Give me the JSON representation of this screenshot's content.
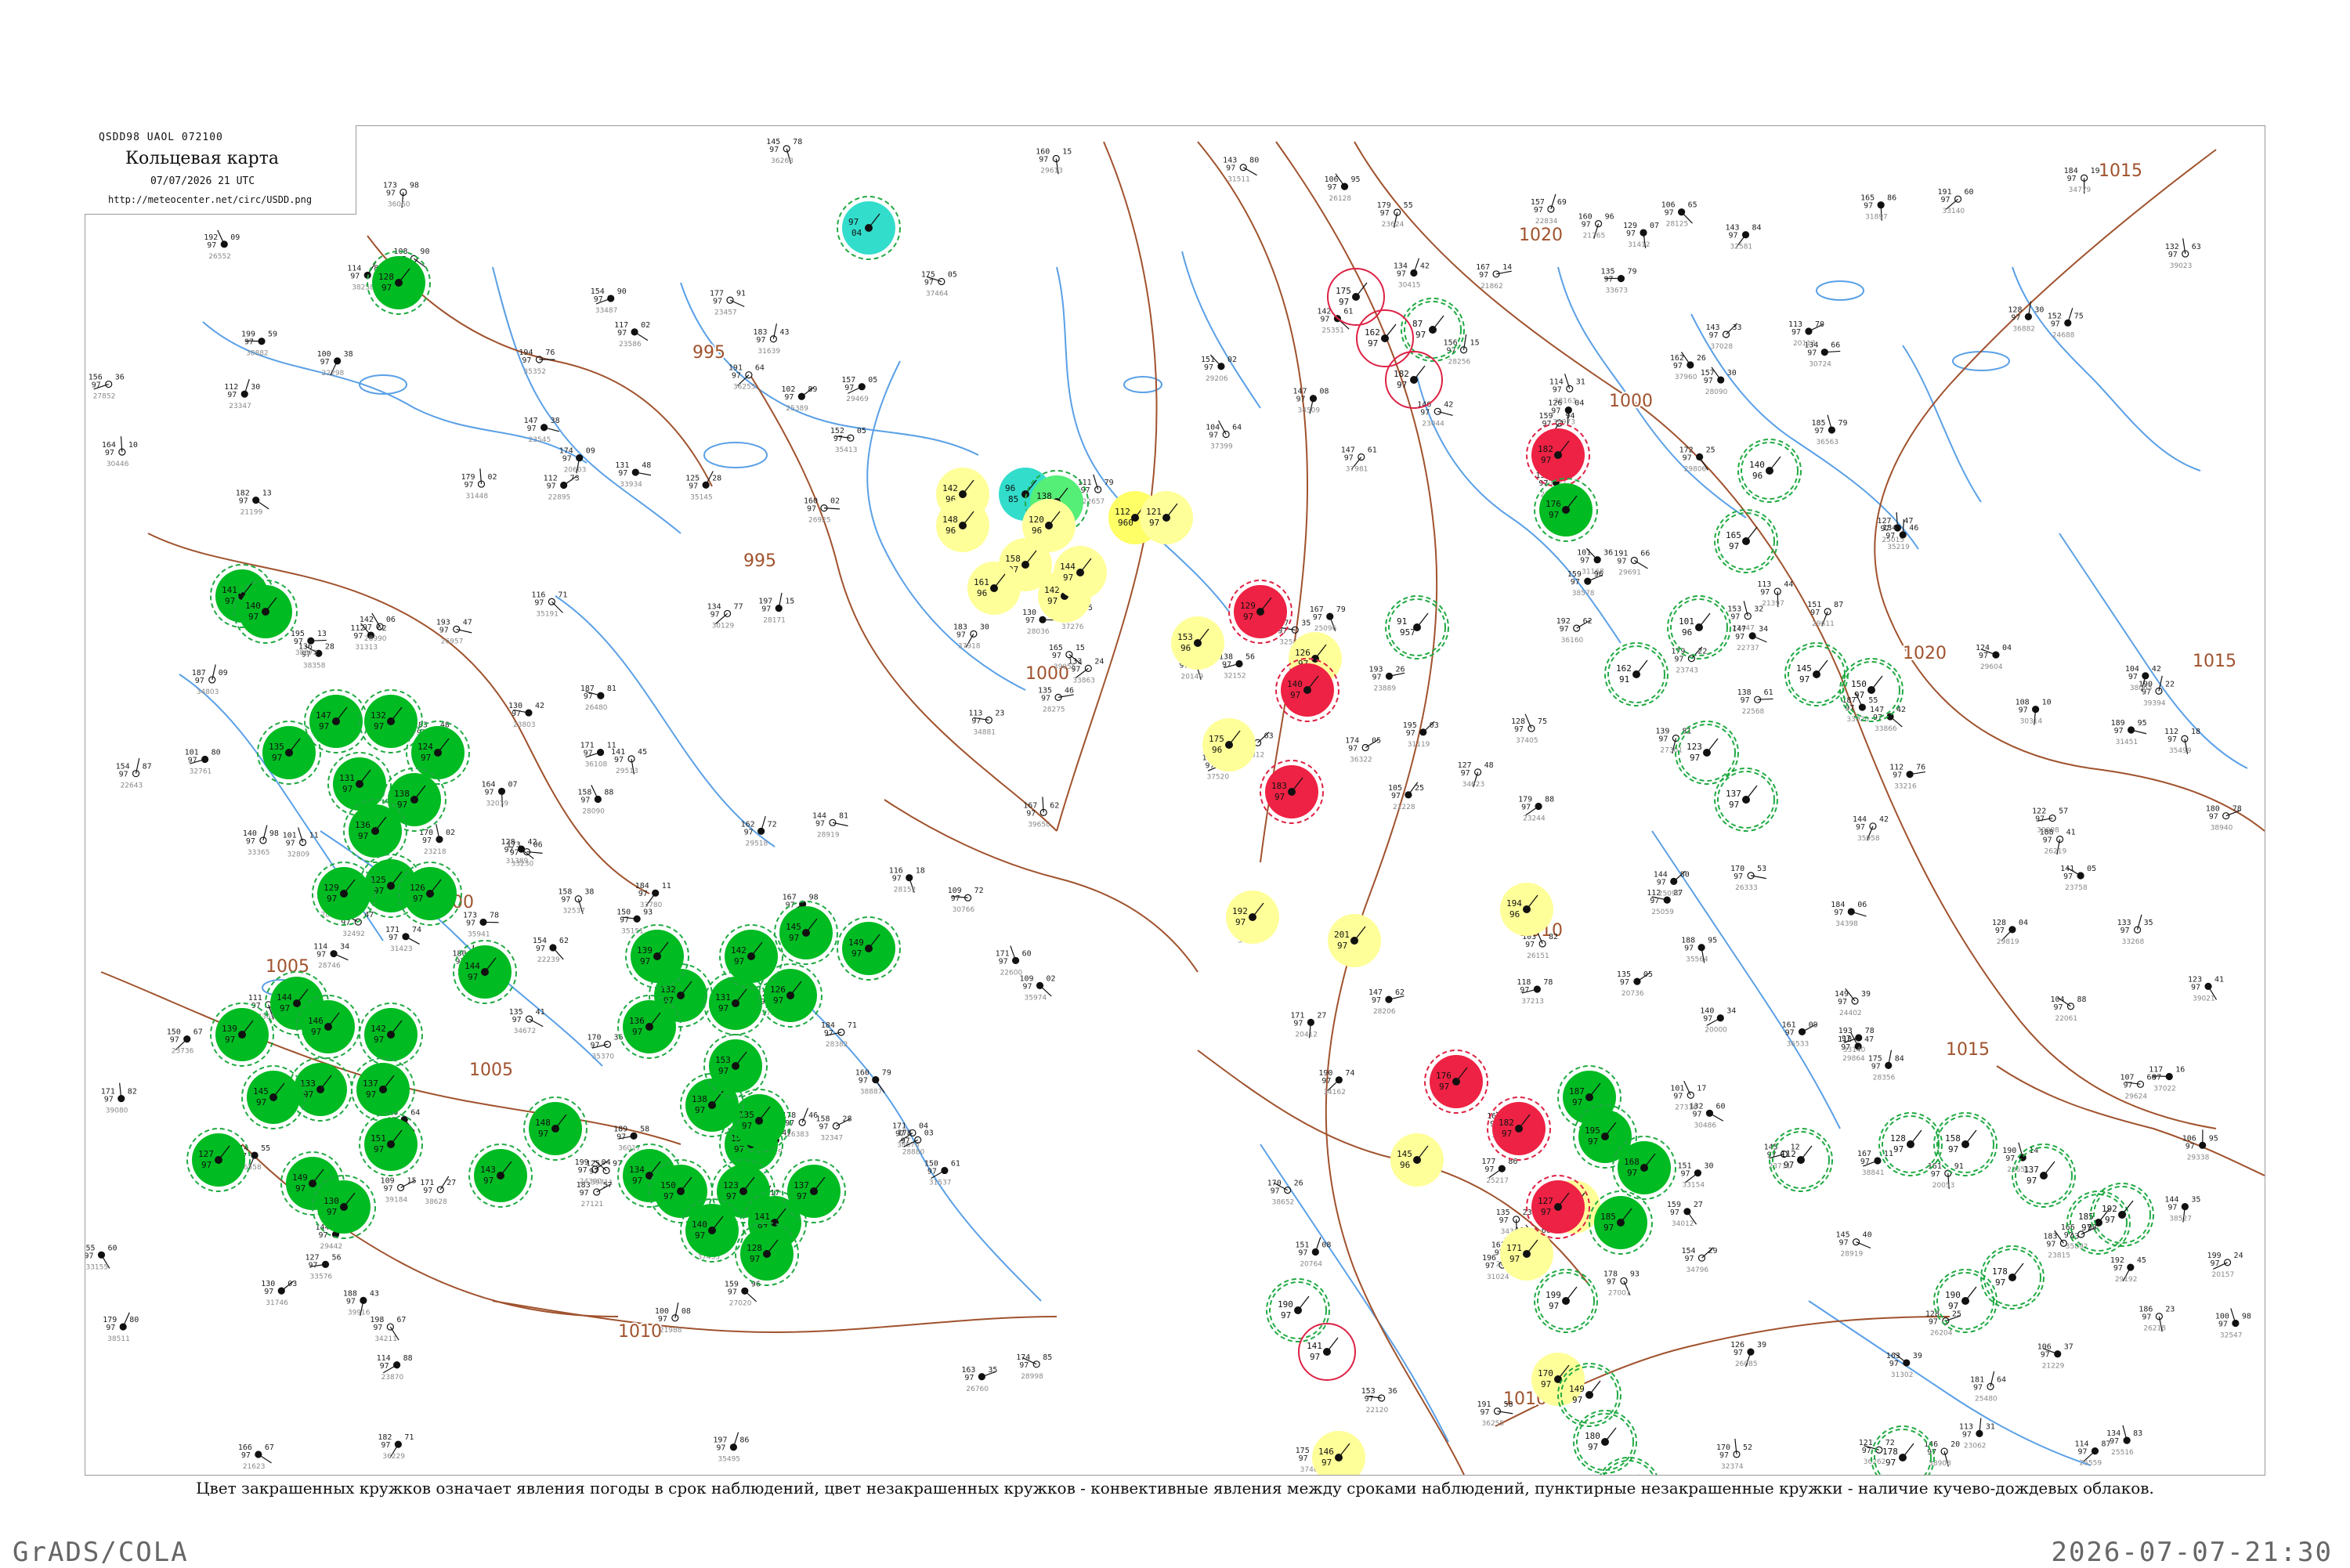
{
  "header": {
    "code": "QSDD98  UAOL  072100",
    "title": "Кольцевая карта",
    "datetime": "07/07/2026 21 UTC",
    "url": "http://meteocenter.net/circ/USDD.png"
  },
  "legend": {
    "text": "Цвет закрашенных кружков означает явления погоды в срок наблюдений, цвет незакрашенных кружков - конвективные явления между сроками наблюдений, пунктирные незакрашенные кружки - наличие кучево-дождевых облаков."
  },
  "footer": {
    "left": "GrADS/COLA",
    "right": "2026-07-07-21:30"
  },
  "colors": {
    "isobar": "#a0522d",
    "river": "#5aa0e6",
    "fill_green": "#00bb22",
    "fill_yellow": "#ffff66",
    "fill_light_yellow": "#ffff99",
    "fill_red": "#ee2244",
    "fill_cyan": "#33ddcc",
    "fill_light_green": "#55ee77",
    "ring_green": "#22aa44",
    "ring_red": "#dd2244",
    "frame": "#9a9a9a"
  },
  "isobar_labels": [
    {
      "text": "1015"
    },
    {
      "text": "1015"
    },
    {
      "text": "1020"
    },
    {
      "text": "1020"
    },
    {
      "text": "1000"
    },
    {
      "text": "1000"
    },
    {
      "text": "995"
    },
    {
      "text": "995"
    },
    {
      "text": "1005"
    },
    {
      "text": "1010"
    },
    {
      "text": "1010"
    },
    {
      "text": "1010"
    },
    {
      "text": "1015"
    },
    {
      "text": "1000"
    },
    {
      "text": "1005"
    }
  ],
  "stations": [
    {
      "kind": "fill_green",
      "dashed": true,
      "t": "128",
      "td": "97"
    },
    {
      "kind": "fill_green",
      "dashed": true,
      "t": "141",
      "td": "97"
    },
    {
      "kind": "fill_green",
      "dashed": true,
      "t": "140",
      "td": "97"
    },
    {
      "kind": "fill_green",
      "dashed": true,
      "t": "135",
      "td": "97"
    },
    {
      "kind": "fill_green",
      "dashed": true,
      "t": "147",
      "td": "97"
    },
    {
      "kind": "fill_green",
      "dashed": true,
      "t": "132",
      "td": "97"
    },
    {
      "kind": "fill_green",
      "dashed": true,
      "t": "124",
      "td": "97"
    },
    {
      "kind": "fill_green",
      "dashed": true,
      "t": "131",
      "td": "97"
    },
    {
      "kind": "fill_green",
      "dashed": true,
      "t": "138",
      "td": "97"
    },
    {
      "kind": "fill_green",
      "dashed": true,
      "t": "136",
      "td": "97"
    },
    {
      "kind": "fill_green",
      "dashed": true,
      "t": "125",
      "td": "97"
    },
    {
      "kind": "fill_green",
      "dashed": true,
      "t": "129",
      "td": "97"
    },
    {
      "kind": "fill_green",
      "dashed": true,
      "t": "126",
      "td": "97"
    },
    {
      "kind": "fill_green",
      "dashed": true,
      "t": "144",
      "td": "97"
    },
    {
      "kind": "fill_green",
      "dashed": true,
      "t": "139",
      "td": "97"
    },
    {
      "kind": "fill_green",
      "dashed": true,
      "t": "146",
      "td": "97"
    },
    {
      "kind": "fill_green",
      "dashed": true,
      "t": "142",
      "td": "97"
    },
    {
      "kind": "fill_green",
      "dashed": true,
      "t": "137",
      "td": "97"
    },
    {
      "kind": "fill_green",
      "dashed": true,
      "t": "133",
      "td": "97"
    },
    {
      "kind": "fill_green",
      "dashed": true,
      "t": "145",
      "td": "97"
    },
    {
      "kind": "fill_green",
      "dashed": true,
      "t": "151",
      "td": "97"
    },
    {
      "kind": "fill_green",
      "dashed": true,
      "t": "127",
      "td": "97"
    },
    {
      "kind": "fill_green",
      "dashed": true,
      "t": "149",
      "td": "97"
    },
    {
      "kind": "fill_green",
      "dashed": true,
      "t": "130",
      "td": "97"
    },
    {
      "kind": "fill_green",
      "dashed": true,
      "t": "143",
      "td": "97"
    },
    {
      "kind": "fill_green",
      "dashed": true,
      "t": "148",
      "td": "97"
    },
    {
      "kind": "fill_green",
      "dashed": true,
      "t": "134",
      "td": "97"
    },
    {
      "kind": "fill_green",
      "dashed": true,
      "t": "150",
      "td": "97"
    },
    {
      "kind": "fill_green",
      "dashed": true,
      "t": "152",
      "td": "97"
    },
    {
      "kind": "fill_green",
      "dashed": true,
      "t": "123",
      "td": "97"
    },
    {
      "kind": "fill_green",
      "dashed": true,
      "t": "141",
      "td": "97"
    },
    {
      "kind": "fill_green",
      "dashed": true,
      "t": "137",
      "td": "97"
    },
    {
      "kind": "fill_green",
      "dashed": true,
      "t": "128",
      "td": "97"
    },
    {
      "kind": "fill_green",
      "dashed": true,
      "t": "140",
      "td": "97"
    },
    {
      "kind": "fill_green",
      "dashed": true,
      "t": "135",
      "td": "97"
    },
    {
      "kind": "fill_green",
      "dashed": true,
      "t": "138",
      "td": "97"
    },
    {
      "kind": "fill_green",
      "dashed": true,
      "t": "132",
      "td": "97"
    },
    {
      "kind": "fill_green",
      "dashed": true,
      "t": "131",
      "td": "97"
    },
    {
      "kind": "fill_green",
      "dashed": true,
      "t": "126",
      "td": "97"
    },
    {
      "kind": "fill_green",
      "dashed": true,
      "t": "136",
      "td": "97"
    },
    {
      "kind": "fill_green",
      "dashed": true,
      "t": "139",
      "td": "97"
    },
    {
      "kind": "fill_green",
      "dashed": true,
      "t": "142",
      "td": "97"
    },
    {
      "kind": "fill_green",
      "dashed": true,
      "t": "145",
      "td": "97"
    },
    {
      "kind": "fill_green",
      "dashed": true,
      "t": "149",
      "td": "97"
    },
    {
      "kind": "fill_green",
      "dashed": true,
      "t": "153",
      "td": "97"
    },
    {
      "kind": "fill_green",
      "dashed": true,
      "t": "144",
      "td": "97"
    },
    {
      "kind": "fill_cyan",
      "dashed": true,
      "t": "97",
      "td": "04"
    },
    {
      "kind": "fill_cyan",
      "dashed": false,
      "t": "96",
      "td": "85"
    },
    {
      "kind": "fill_light_green",
      "dashed": true,
      "t": "138",
      "td": "97"
    },
    {
      "kind": "fill_yellow",
      "dashed": false,
      "t": "112",
      "td": "960"
    },
    {
      "kind": "fill_light_yellow",
      "dashed": false,
      "t": "121",
      "td": "97"
    },
    {
      "kind": "fill_light_yellow",
      "dashed": false,
      "t": "142",
      "td": "96"
    },
    {
      "kind": "fill_light_yellow",
      "dashed": false,
      "t": "148",
      "td": "96"
    },
    {
      "kind": "fill_light_yellow",
      "dashed": false,
      "t": "158",
      "td": "97"
    },
    {
      "kind": "fill_light_yellow",
      "dashed": false,
      "t": "161",
      "td": "96"
    },
    {
      "kind": "fill_light_yellow",
      "dashed": false,
      "t": "142",
      "td": "97"
    },
    {
      "kind": "fill_light_yellow",
      "dashed": false,
      "t": "144",
      "td": "97"
    },
    {
      "kind": "fill_light_yellow",
      "dashed": false,
      "t": "120",
      "td": "96"
    },
    {
      "kind": "fill_light_yellow",
      "dashed": false,
      "t": "145",
      "td": "96"
    },
    {
      "kind": "fill_light_yellow",
      "dashed": false,
      "t": "126",
      "td": "97"
    },
    {
      "kind": "fill_light_yellow",
      "dashed": false,
      "t": "153",
      "td": "96"
    },
    {
      "kind": "fill_light_yellow",
      "dashed": false,
      "t": "175",
      "td": "96"
    },
    {
      "kind": "fill_light_yellow",
      "dashed": false,
      "t": "192",
      "td": "97"
    },
    {
      "kind": "fill_light_yellow",
      "dashed": false,
      "t": "201",
      "td": "97"
    },
    {
      "kind": "fill_light_yellow",
      "dashed": false,
      "t": "194",
      "td": "96"
    },
    {
      "kind": "fill_light_yellow",
      "dashed": false,
      "t": "187",
      "td": "97"
    },
    {
      "kind": "fill_light_yellow",
      "dashed": false,
      "t": "171",
      "td": "97"
    },
    {
      "kind": "fill_light_yellow",
      "dashed": false,
      "t": "170",
      "td": "97"
    },
    {
      "kind": "fill_light_yellow",
      "dashed": false,
      "t": "146",
      "td": "97"
    },
    {
      "kind": "fill_red",
      "dashed": true,
      "t": "127",
      "td": "97"
    },
    {
      "kind": "fill_red",
      "dashed": true,
      "t": "129",
      "td": "97"
    },
    {
      "kind": "fill_red",
      "dashed": true,
      "t": "140",
      "td": "97"
    },
    {
      "kind": "fill_red",
      "dashed": true,
      "t": "183",
      "td": "97"
    },
    {
      "kind": "fill_red",
      "dashed": true,
      "t": "176",
      "td": "97"
    },
    {
      "kind": "fill_red",
      "dashed": true,
      "t": "182",
      "td": "97"
    },
    {
      "kind": "fill_red",
      "dashed": true,
      "t": "182",
      "td": "97"
    },
    {
      "kind": "fill_green",
      "dashed": true,
      "t": "176",
      "td": "97"
    },
    {
      "kind": "fill_green",
      "dashed": true,
      "t": "187",
      "td": "97"
    },
    {
      "kind": "fill_green",
      "dashed": true,
      "t": "195",
      "td": "97"
    },
    {
      "kind": "fill_green",
      "dashed": true,
      "t": "168",
      "td": "97"
    },
    {
      "kind": "fill_green",
      "dashed": true,
      "t": "185",
      "td": "97"
    },
    {
      "kind": "ring_green",
      "dashed": true,
      "t": "87",
      "td": "97"
    },
    {
      "kind": "ring_green",
      "dashed": true,
      "t": "91",
      "td": "957"
    },
    {
      "kind": "ring_green",
      "dashed": true,
      "t": "140",
      "td": "96"
    },
    {
      "kind": "ring_green",
      "dashed": true,
      "t": "165",
      "td": "97"
    },
    {
      "kind": "ring_green",
      "dashed": true,
      "t": "162",
      "td": "91"
    },
    {
      "kind": "ring_green",
      "dashed": true,
      "t": "101",
      "td": "96"
    },
    {
      "kind": "ring_green",
      "dashed": true,
      "t": "123",
      "td": "97"
    },
    {
      "kind": "ring_green",
      "dashed": true,
      "t": "137",
      "td": "97"
    },
    {
      "kind": "ring_green",
      "dashed": true,
      "t": "145",
      "td": "97"
    },
    {
      "kind": "ring_green",
      "dashed": true,
      "t": "150",
      "td": "97"
    },
    {
      "kind": "ring_green",
      "dashed": true,
      "t": "112",
      "td": "97"
    },
    {
      "kind": "ring_green",
      "dashed": true,
      "t": "128",
      "td": "97"
    },
    {
      "kind": "ring_green",
      "dashed": true,
      "t": "158",
      "td": "97"
    },
    {
      "kind": "ring_green",
      "dashed": true,
      "t": "137",
      "td": "97"
    },
    {
      "kind": "ring_green",
      "dashed": true,
      "t": "185",
      "td": "97"
    },
    {
      "kind": "ring_green",
      "dashed": true,
      "t": "178",
      "td": "97"
    },
    {
      "kind": "ring_green",
      "dashed": true,
      "t": "192",
      "td": "97"
    },
    {
      "kind": "ring_green",
      "dashed": true,
      "t": "190",
      "td": "97"
    },
    {
      "kind": "ring_green",
      "dashed": true,
      "t": "178",
      "td": "97"
    },
    {
      "kind": "ring_green",
      "dashed": true,
      "t": "199",
      "td": "97"
    },
    {
      "kind": "ring_green",
      "dashed": true,
      "t": "149",
      "td": "97"
    },
    {
      "kind": "ring_green",
      "dashed": true,
      "t": "180",
      "td": "97"
    },
    {
      "kind": "ring_green",
      "dashed": true,
      "t": "119",
      "td": "97"
    },
    {
      "kind": "ring_green",
      "dashed": true,
      "t": "190",
      "td": "97"
    },
    {
      "kind": "ring_red",
      "dashed": false,
      "t": "141",
      "td": "97"
    },
    {
      "kind": "ring_red",
      "dashed": false,
      "t": "175",
      "td": "97"
    },
    {
      "kind": "ring_red",
      "dashed": false,
      "t": "162",
      "td": "97"
    },
    {
      "kind": "ring_red",
      "dashed": false,
      "t": "182",
      "td": "97"
    }
  ]
}
